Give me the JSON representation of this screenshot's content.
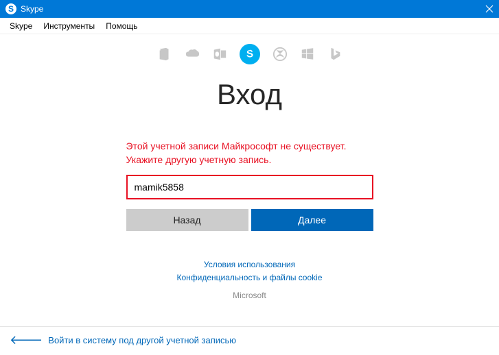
{
  "window": {
    "title": "Skype",
    "icon_letter": "S"
  },
  "menu": {
    "skype": "Skype",
    "tools": "Инструменты",
    "help": "Помощь"
  },
  "page": {
    "title": "Вход"
  },
  "error": {
    "line1": "Этой учетной записи Майкрософт не существует.",
    "line2": "Укажите другую учетную запись."
  },
  "input": {
    "value": "mamik5858"
  },
  "buttons": {
    "back": "Назад",
    "next": "Далее"
  },
  "links": {
    "terms": "Условия использования",
    "privacy": "Конфиденциальность и файлы cookie",
    "microsoft": "Microsoft"
  },
  "footer": {
    "other_account": "Войти в систему под другой учетной записью"
  },
  "icons": {
    "office": "office-icon",
    "onedrive": "onedrive-icon",
    "outlook": "outlook-icon",
    "skype": "skype-icon",
    "xbox": "xbox-icon",
    "windows": "windows-icon",
    "bing": "bing-icon"
  }
}
